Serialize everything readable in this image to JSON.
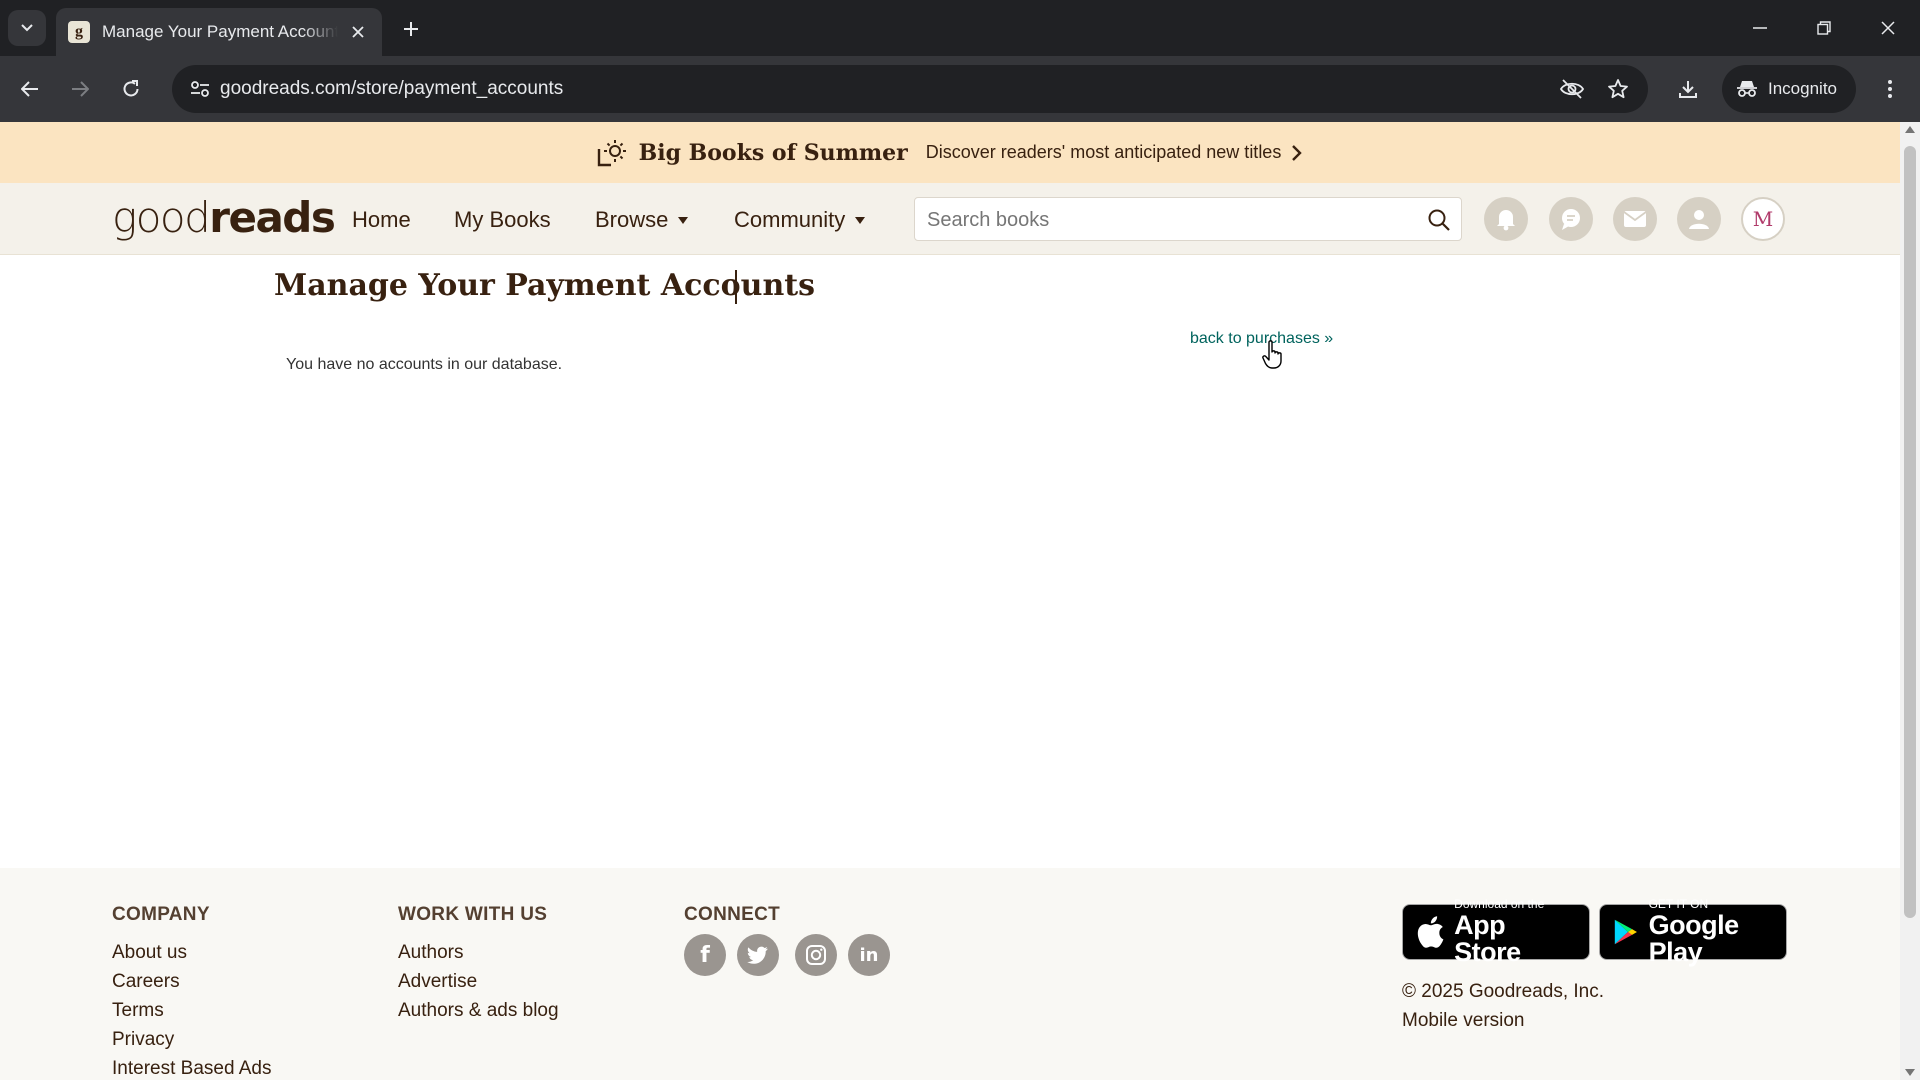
{
  "browser": {
    "tab_title": "Manage Your Payment Accounts",
    "url": "goodreads.com/store/payment_accounts",
    "incognito_label": "Incognito",
    "icons": [
      "tab-search-icon",
      "close-icon",
      "plus-icon",
      "minimize-icon",
      "restore-icon",
      "back-icon",
      "forward-icon",
      "reload-icon",
      "site-info-icon",
      "eye-off-icon",
      "star-icon",
      "download-icon",
      "incognito-icon",
      "kebab-menu-icon"
    ]
  },
  "promo": {
    "title": "Big Books of Summer",
    "subtitle": "Discover readers' most anticipated new titles"
  },
  "header": {
    "logo_light": "good",
    "logo_bold": "reads",
    "nav": {
      "home": "Home",
      "my_books": "My Books",
      "browse": "Browse",
      "community": "Community"
    },
    "search_placeholder": "Search books",
    "avatar_initial": "M"
  },
  "main": {
    "title": "Manage Your Payment Accounts",
    "back_link": "back to purchases »",
    "empty_message": "You have no accounts in our database."
  },
  "footer": {
    "company": {
      "heading": "COMPANY",
      "links": [
        "About us",
        "Careers",
        "Terms",
        "Privacy",
        "Interest Based Ads"
      ]
    },
    "work": {
      "heading": "WORK WITH US",
      "links": [
        "Authors",
        "Advertise",
        "Authors & ads blog"
      ]
    },
    "connect": {
      "heading": "CONNECT",
      "facebook": "f",
      "linkedin": "in"
    },
    "app_store": {
      "small": "Download on the",
      "big": "App Store"
    },
    "google_play": {
      "small": "GET IT ON",
      "big": "Google Play"
    },
    "copyright": "© 2025 Goodreads, Inc.",
    "mobile": "Mobile version"
  },
  "colors": {
    "brand_brown": "#382110",
    "promo_bg": "#fbe4c1",
    "header_bg": "#f4f1ea",
    "link_teal": "#00635d"
  }
}
